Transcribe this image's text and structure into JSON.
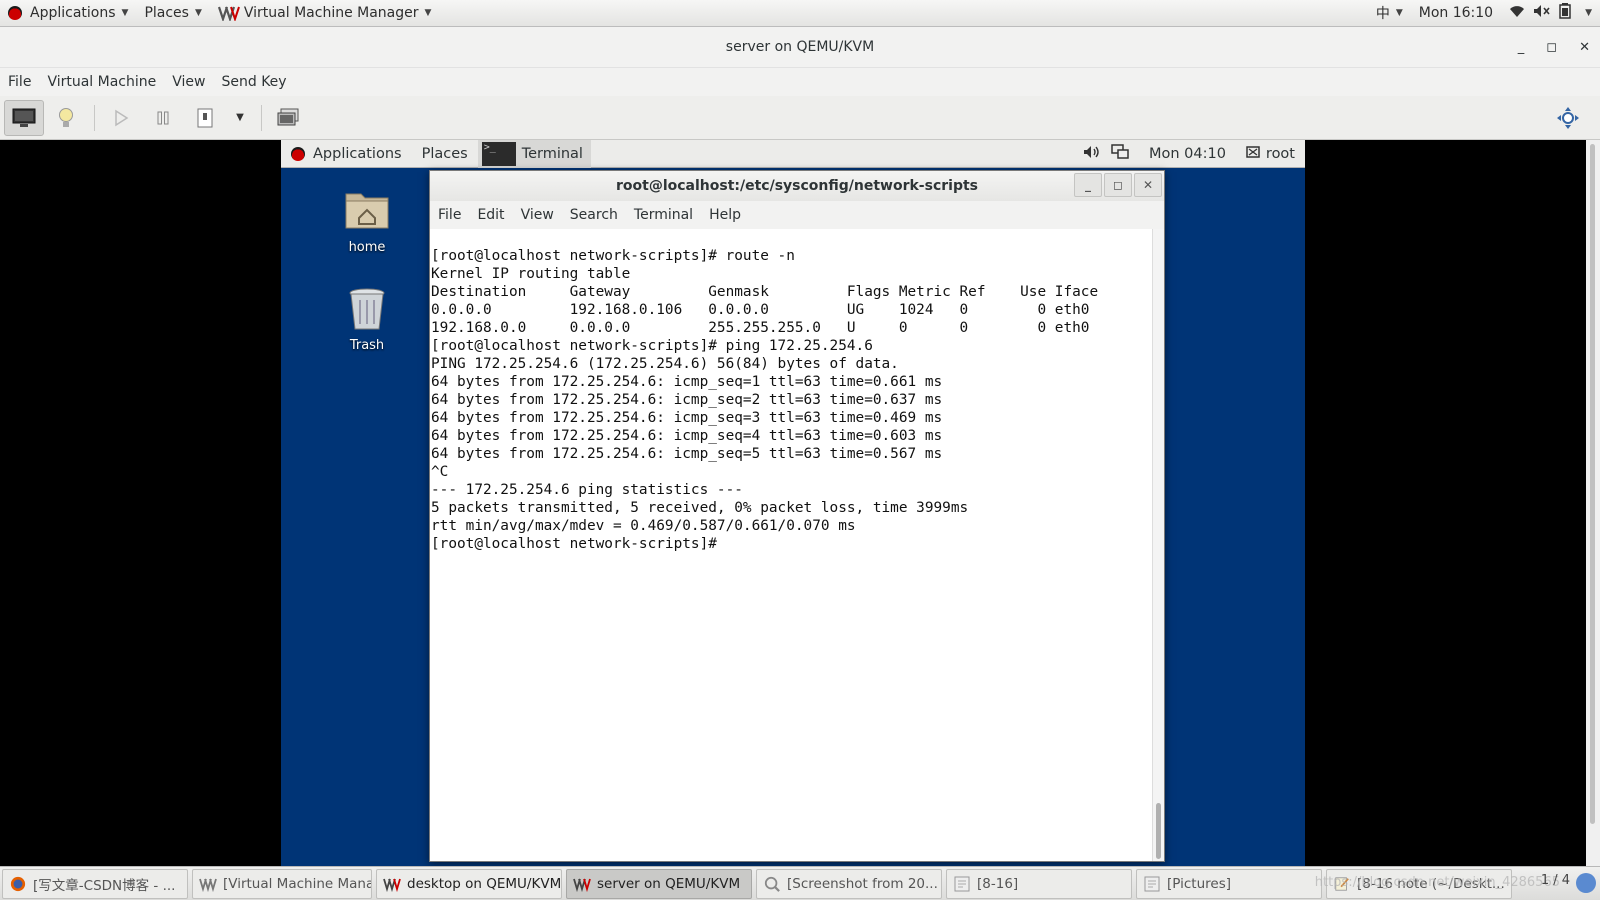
{
  "host_topbar": {
    "applications": "Applications",
    "places": "Places",
    "app_name": "Virtual Machine Manager",
    "input_method": "中",
    "clock": "Mon 16:10"
  },
  "vmm_window": {
    "title": "server on QEMU/KVM",
    "menu": [
      "File",
      "Virtual Machine",
      "View",
      "Send Key"
    ]
  },
  "guest": {
    "panel": {
      "applications": "Applications",
      "places": "Places",
      "terminal_task": "Terminal",
      "clock": "Mon 04:10",
      "user": "root"
    },
    "desktop_icons": [
      {
        "label": "home"
      },
      {
        "label": "Trash"
      }
    ],
    "terminal": {
      "title": "root@localhost:/etc/sysconfig/network-scripts",
      "menu": [
        "File",
        "Edit",
        "View",
        "Search",
        "Terminal",
        "Help"
      ],
      "lines": [
        "[root@localhost network-scripts]# route -n",
        "Kernel IP routing table",
        "Destination     Gateway         Genmask         Flags Metric Ref    Use Iface",
        "0.0.0.0         192.168.0.106   0.0.0.0         UG    1024   0        0 eth0",
        "192.168.0.0     0.0.0.0         255.255.255.0   U     0      0        0 eth0",
        "[root@localhost network-scripts]# ping 172.25.254.6",
        "PING 172.25.254.6 (172.25.254.6) 56(84) bytes of data.",
        "64 bytes from 172.25.254.6: icmp_seq=1 ttl=63 time=0.661 ms",
        "64 bytes from 172.25.254.6: icmp_seq=2 ttl=63 time=0.637 ms",
        "64 bytes from 172.25.254.6: icmp_seq=3 ttl=63 time=0.469 ms",
        "64 bytes from 172.25.254.6: icmp_seq=4 ttl=63 time=0.603 ms",
        "64 bytes from 172.25.254.6: icmp_seq=5 ttl=63 time=0.567 ms",
        "^C",
        "--- 172.25.254.6 ping statistics ---",
        "5 packets transmitted, 5 received, 0% packet loss, time 3999ms",
        "rtt min/avg/max/mdev = 0.469/0.587/0.661/0.070 ms",
        "[root@localhost network-scripts]# "
      ]
    }
  },
  "host_taskbar": {
    "items": [
      {
        "label": "[写文章-CSDN博客 - ...",
        "icon": "firefox-icon",
        "active": false
      },
      {
        "label": "[Virtual Machine Mana...",
        "icon": "vmm-icon",
        "active": false
      },
      {
        "label": "desktop on QEMU/KVM",
        "icon": "vmm-icon",
        "active": false
      },
      {
        "label": "server on QEMU/KVM",
        "icon": "vmm-icon",
        "active": true
      },
      {
        "label": "[Screenshot from 20...",
        "icon": "screenshot-icon",
        "active": false
      },
      {
        "label": "[8-16]",
        "icon": "folder-icon",
        "active": false
      },
      {
        "label": "[Pictures]",
        "icon": "folder-icon",
        "active": false
      },
      {
        "label": "[8-16 note (~/Deskt...",
        "icon": "editor-icon",
        "active": false
      }
    ],
    "pager": "1 / 4",
    "watermark": "https://blog.csdn.net/weixin_4286565"
  },
  "colors": {
    "guest_desktop": "#003476",
    "host_panel": "#ececea",
    "terminal_bg": "#ffffff"
  }
}
